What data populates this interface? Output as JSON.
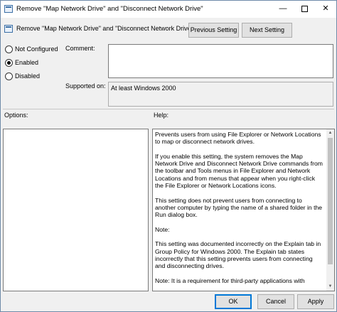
{
  "window": {
    "title": "Remove \"Map Network Drive\" and \"Disconnect Network Drive\"",
    "minimize_glyph": "—",
    "close_glyph": "✕"
  },
  "header": {
    "setting_name": "Remove \"Map Network Drive\" and \"Disconnect Network Drive\"",
    "previous_label": "Previous Setting",
    "next_label": "Next Setting"
  },
  "state": {
    "options": [
      {
        "label": "Not Configured",
        "checked": false
      },
      {
        "label": "Enabled",
        "checked": true
      },
      {
        "label": "Disabled",
        "checked": false
      }
    ]
  },
  "comment": {
    "label": "Comment:",
    "value": ""
  },
  "supported": {
    "label": "Supported on:",
    "value": "At least Windows 2000"
  },
  "options_panel": {
    "label": "Options:"
  },
  "help_panel": {
    "label": "Help:",
    "paragraphs": [
      "Prevents users from using File Explorer or Network Locations to map or disconnect network drives.",
      "If you enable this setting, the system removes the Map Network Drive and Disconnect Network Drive commands from the toolbar and Tools menus in File Explorer and Network Locations and from menus that appear when you right-click the File Explorer or Network Locations icons.",
      "This setting does not prevent users from connecting to another computer by typing the name of a shared folder in the Run dialog box.",
      "Note:",
      "This setting was documented incorrectly on the Explain tab in Group Policy for Windows 2000. The Explain tab states incorrectly that this setting prevents users from connecting and disconnecting drives.",
      "Note: It is a requirement for third-party applications with"
    ],
    "scroll_up_glyph": "▲",
    "scroll_down_glyph": "▼"
  },
  "footer": {
    "ok_label": "OK",
    "cancel_label": "Cancel",
    "apply_label": "Apply"
  }
}
